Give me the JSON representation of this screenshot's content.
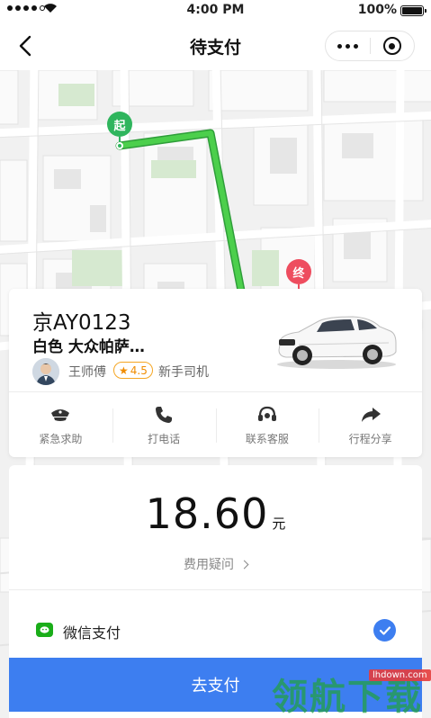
{
  "status_bar": {
    "time": "4:00 PM",
    "battery": "100%"
  },
  "nav": {
    "title": "待支付"
  },
  "map": {
    "start_label": "起",
    "end_label": "终",
    "route_color": "#3fbf3f",
    "start_color": "#2fb55d",
    "end_color": "#ee4d5f"
  },
  "driver": {
    "plate": "京AY0123",
    "car_desc": "白色 大众帕萨…",
    "name": "王师傅",
    "rating": "4.5",
    "tag": "新手司机"
  },
  "actions": [
    {
      "label": "紧急求助",
      "icon": "police-cap-icon"
    },
    {
      "label": "打电话",
      "icon": "phone-icon"
    },
    {
      "label": "联系客服",
      "icon": "headset-icon"
    },
    {
      "label": "行程分享",
      "icon": "share-arrow-icon"
    }
  ],
  "payment": {
    "amount": "18.60",
    "currency": "元",
    "fee_question": "费用疑问",
    "method": "微信支付",
    "pay_button": "去支付"
  },
  "watermark": {
    "text": "领航下载",
    "url": "lhdown.com"
  },
  "colors": {
    "accent": "#3d7ef0",
    "wechat": "#1aad19",
    "rating": "#f5a623"
  }
}
